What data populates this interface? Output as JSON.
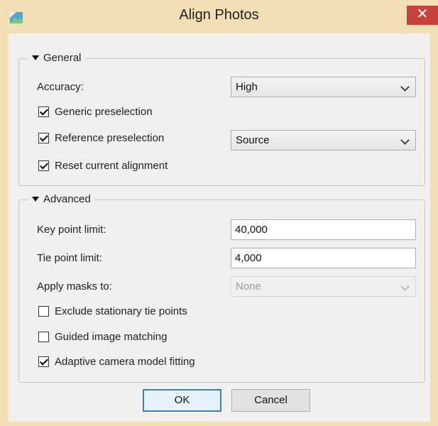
{
  "window": {
    "title": "Align Photos",
    "close_glyph": "✕",
    "app_icon": "photoscan-app-icon",
    "colors": {
      "titlebar": "#f2e0b4",
      "close_button": "#c7423b",
      "default_button_border": "#3c7fb1"
    }
  },
  "general": {
    "legend": "General",
    "accuracy_label": "Accuracy:",
    "accuracy_value": "High",
    "generic_preselection_label": "Generic preselection",
    "generic_preselection_checked": true,
    "reference_preselection_label": "Reference preselection",
    "reference_preselection_checked": true,
    "reference_source_value": "Source",
    "reset_alignment_label": "Reset current alignment",
    "reset_alignment_checked": true
  },
  "advanced": {
    "legend": "Advanced",
    "key_point_limit_label": "Key point limit:",
    "key_point_limit_value": "40,000",
    "tie_point_limit_label": "Tie point limit:",
    "tie_point_limit_value": "4,000",
    "apply_masks_label": "Apply masks to:",
    "apply_masks_value": "None",
    "exclude_stationary_label": "Exclude stationary tie points",
    "exclude_stationary_checked": false,
    "guided_matching_label": "Guided image matching",
    "guided_matching_checked": false,
    "adaptive_fitting_label": "Adaptive camera model fitting",
    "adaptive_fitting_checked": true
  },
  "buttons": {
    "ok": "OK",
    "cancel": "Cancel"
  }
}
